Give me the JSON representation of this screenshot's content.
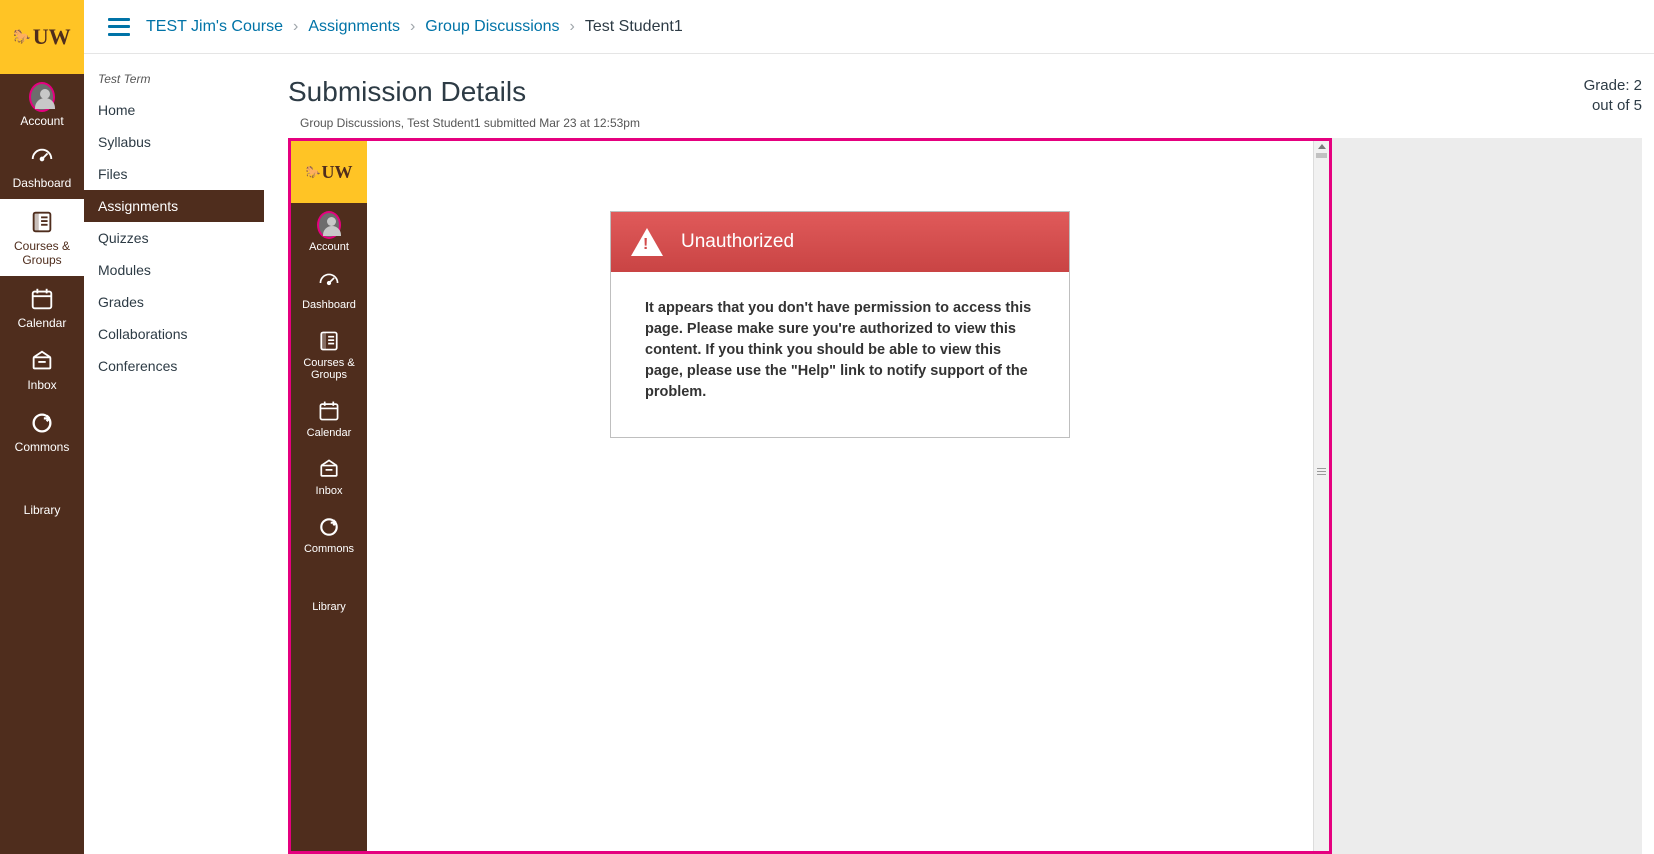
{
  "logo_text": "UW",
  "global_nav": [
    {
      "label": "Account",
      "icon": "avatar"
    },
    {
      "label": "Dashboard",
      "icon": "dashboard"
    },
    {
      "label": "Courses & Groups",
      "icon": "courses",
      "active": true
    },
    {
      "label": "Calendar",
      "icon": "calendar"
    },
    {
      "label": "Inbox",
      "icon": "inbox"
    },
    {
      "label": "Commons",
      "icon": "commons"
    },
    {
      "label": "Library",
      "icon": "library"
    }
  ],
  "breadcrumbs": [
    {
      "label": "TEST Jim's Course",
      "link": true
    },
    {
      "label": "Assignments",
      "link": true
    },
    {
      "label": "Group Discussions",
      "link": true
    },
    {
      "label": "Test Student1",
      "link": false
    }
  ],
  "term_label": "Test Term",
  "course_nav": [
    {
      "label": "Home"
    },
    {
      "label": "Syllabus"
    },
    {
      "label": "Files"
    },
    {
      "label": "Assignments",
      "active": true
    },
    {
      "label": "Quizzes"
    },
    {
      "label": "Modules"
    },
    {
      "label": "Grades"
    },
    {
      "label": "Collaborations"
    },
    {
      "label": "Conferences"
    }
  ],
  "page_title": "Submission Details",
  "submission_meta": "Group Discussions, Test Student1    submitted Mar 23 at 12:53pm",
  "grade": {
    "line1": "Grade: 2",
    "line2": "out of 5"
  },
  "inner_nav": [
    {
      "label": "Account",
      "icon": "avatar"
    },
    {
      "label": "Dashboard",
      "icon": "dashboard"
    },
    {
      "label": "Courses & Groups",
      "icon": "courses"
    },
    {
      "label": "Calendar",
      "icon": "calendar"
    },
    {
      "label": "Inbox",
      "icon": "inbox"
    },
    {
      "label": "Commons",
      "icon": "commons"
    },
    {
      "label": "Library",
      "icon": "library"
    }
  ],
  "error": {
    "title": "Unauthorized",
    "body": "It appears that you don't have permission to access this page. Please make sure you're authorized to view this content. If you think you should be able to view this page, please use the \"Help\" link to notify support of the problem."
  }
}
